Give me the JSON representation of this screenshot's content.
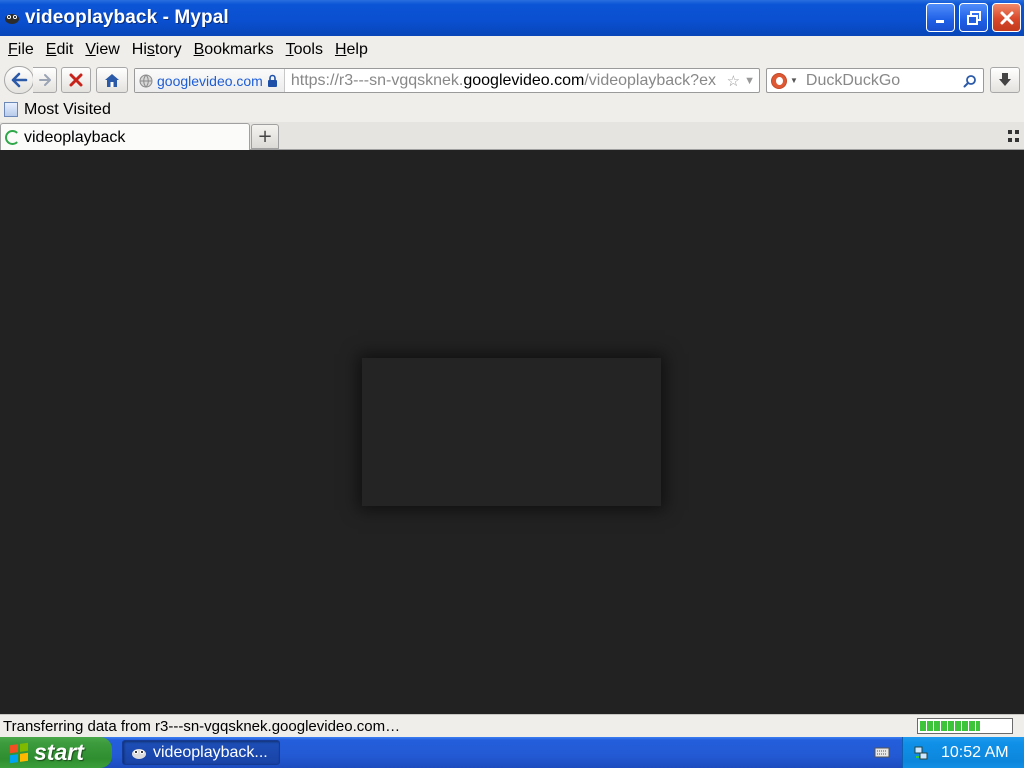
{
  "window": {
    "title": "videoplayback - Mypal",
    "buttons": [
      "minimize-icon",
      "restore-icon",
      "close-icon"
    ]
  },
  "menubar": {
    "items": [
      {
        "label": "File",
        "key": "F",
        "rest": "ile"
      },
      {
        "label": "Edit",
        "key": "E",
        "rest": "dit"
      },
      {
        "label": "View",
        "key": "V",
        "rest": "iew"
      },
      {
        "label": "History",
        "key": "",
        "rest": "History",
        "underline_index": 2
      },
      {
        "label": "Bookmarks",
        "key": "B",
        "rest": "ookmarks"
      },
      {
        "label": "Tools",
        "key": "T",
        "rest": "ools"
      },
      {
        "label": "Help",
        "key": "H",
        "rest": "elp"
      }
    ]
  },
  "navbar": {
    "identity_domain": "googlevideo.com",
    "url_prefix": "https://r3---sn-vgqsknek.",
    "url_domain": "googlevideo.com",
    "url_suffix": "/videoplayback?ex",
    "search_placeholder": "DuckDuckGo"
  },
  "bookmarks": {
    "most_visited": "Most Visited"
  },
  "tabs": [
    {
      "label": "videoplayback",
      "loading": true
    }
  ],
  "newtab_label": "+",
  "status": {
    "text": "Transferring data from r3---sn-vgqsknek.googlevideo.com…",
    "progress_fraction": 0.67
  },
  "taskbar": {
    "start_label": "start",
    "task_label": "videoplayback...",
    "clock": "10:52 AM"
  },
  "colors": {
    "content_bg": "#222222",
    "titlebar": "#0a4fcf",
    "start_green": "#3c9b3c",
    "tray_blue": "#0c86dc"
  }
}
